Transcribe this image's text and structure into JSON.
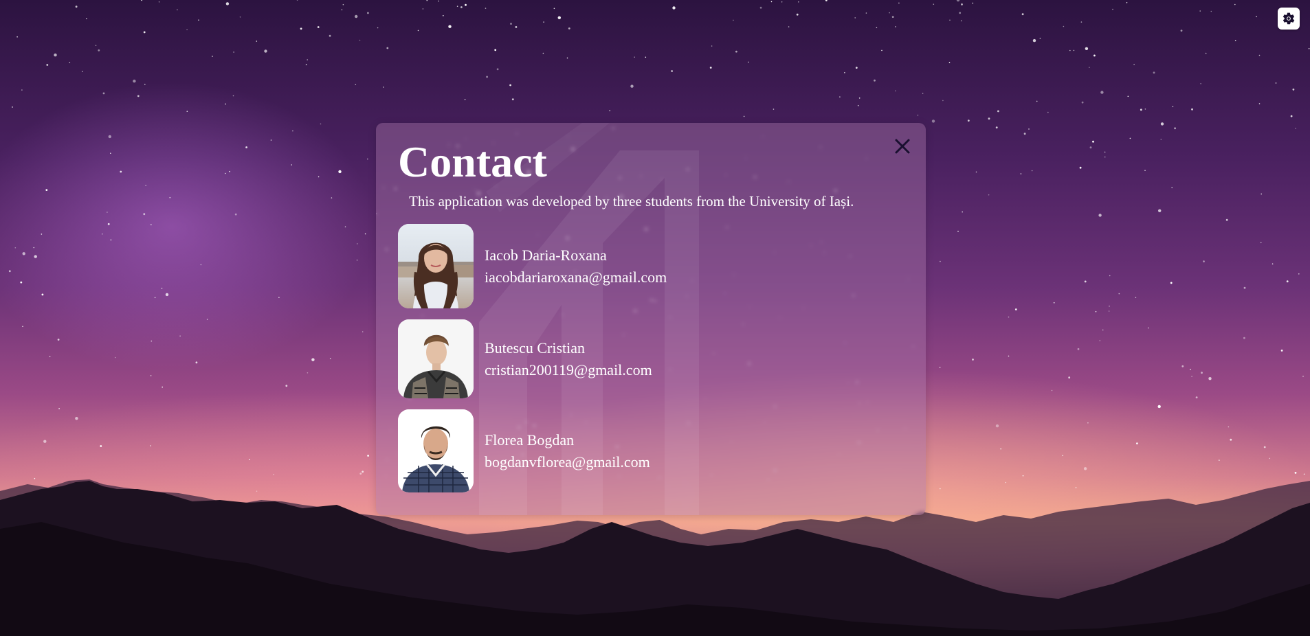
{
  "settings": {
    "icon": "gear-icon"
  },
  "modal": {
    "title": "Contact",
    "subtitle": "This application was developed by three students from the University of Iași.",
    "close_icon": "close-icon",
    "contacts": [
      {
        "name": "Iacob Daria-Roxana",
        "email": "iacobdariaroxana@gmail.com",
        "avatar_icon": "avatar-photo"
      },
      {
        "name": "Butescu Cristian",
        "email": "cristian200119@gmail.com",
        "avatar_icon": "avatar-photo"
      },
      {
        "name": "Florea Bogdan",
        "email": "bogdanvflorea@gmail.com",
        "avatar_icon": "avatar-photo"
      }
    ]
  },
  "colors": {
    "sky_top": "#2c1340",
    "horizon": "#f0a58e",
    "modal_tint": "#aa78aa",
    "text": "#ffffff"
  }
}
